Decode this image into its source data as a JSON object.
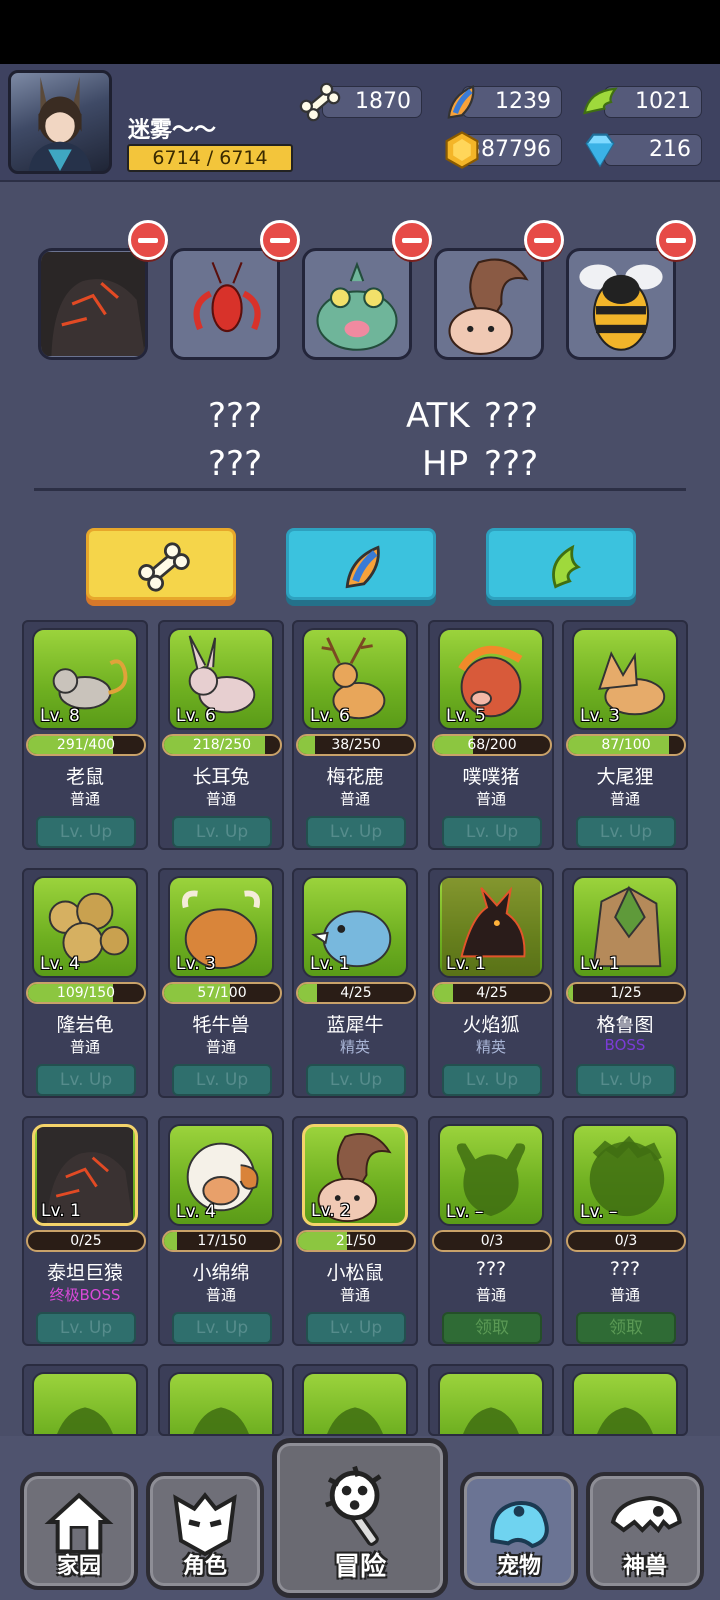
{
  "player": {
    "name": "迷雾～～",
    "hp": "6714 / 6714"
  },
  "resources": {
    "bone": "1870",
    "feather": "1239",
    "wing": "1021",
    "coin": "387796",
    "gem": "216"
  },
  "team": [
    "titan-ape",
    "red-mantis",
    "horned-frog",
    "squirrel",
    "bee"
  ],
  "stats": {
    "left_top": "???",
    "left_bottom": "???",
    "atk_label": "ATK",
    "atk_value": "???",
    "hp_label": "HP",
    "hp_value": "???"
  },
  "pets": [
    {
      "name": "老鼠",
      "rarity": "普通",
      "level": "Lv. 8",
      "xp": "291/400",
      "progress": 0.73,
      "action": "Lv. Up"
    },
    {
      "name": "长耳兔",
      "rarity": "普通",
      "level": "Lv. 6",
      "xp": "218/250",
      "progress": 0.87,
      "action": "Lv. Up"
    },
    {
      "name": "梅花鹿",
      "rarity": "普通",
      "level": "Lv. 6",
      "xp": "38/250",
      "progress": 0.15,
      "action": "Lv. Up"
    },
    {
      "name": "噗噗猪",
      "rarity": "普通",
      "level": "Lv. 5",
      "xp": "68/200",
      "progress": 0.34,
      "action": "Lv. Up"
    },
    {
      "name": "大尾狸",
      "rarity": "普通",
      "level": "Lv. 3",
      "xp": "87/100",
      "progress": 0.87,
      "action": "Lv. Up"
    },
    {
      "name": "隆岩龟",
      "rarity": "普通",
      "level": "Lv. 4",
      "xp": "109/150",
      "progress": 0.73,
      "action": "Lv. Up"
    },
    {
      "name": "牦牛兽",
      "rarity": "普通",
      "level": "Lv. 3",
      "xp": "57/100",
      "progress": 0.57,
      "action": "Lv. Up"
    },
    {
      "name": "蓝犀牛",
      "rarity": "精英",
      "level": "Lv. 1",
      "xp": "4/25",
      "progress": 0.16,
      "action": "Lv. Up"
    },
    {
      "name": "火焰狐",
      "rarity": "精英",
      "level": "Lv. 1",
      "xp": "4/25",
      "progress": 0.16,
      "action": "Lv. Up"
    },
    {
      "name": "格鲁图",
      "rarity": "BOSS",
      "level": "Lv. 1",
      "xp": "1/25",
      "progress": 0.04,
      "action": "Lv. Up"
    },
    {
      "name": "泰坦巨猿",
      "rarity": "终极BOSS",
      "level": "Lv. 1",
      "xp": "0/25",
      "progress": 0,
      "action": "Lv. Up"
    },
    {
      "name": "小绵绵",
      "rarity": "普通",
      "level": "Lv. 4",
      "xp": "17/150",
      "progress": 0.11,
      "action": "Lv. Up"
    },
    {
      "name": "小松鼠",
      "rarity": "普通",
      "level": "Lv. 2",
      "xp": "21/50",
      "progress": 0.42,
      "action": "Lv. Up"
    },
    {
      "name": "???",
      "rarity": "普通",
      "level": "Lv. –",
      "xp": "0/3",
      "progress": 0,
      "action": "领取"
    },
    {
      "name": "???",
      "rarity": "普通",
      "level": "Lv. –",
      "xp": "0/3",
      "progress": 0,
      "action": "领取"
    }
  ],
  "nav": [
    "家园",
    "角色",
    "冒险",
    "宠物",
    "神兽"
  ],
  "colors": {
    "accent": "#f5d54a",
    "cyan": "#3bc2de",
    "xp_fill": "#8cc640",
    "remove": "#e64b47"
  }
}
